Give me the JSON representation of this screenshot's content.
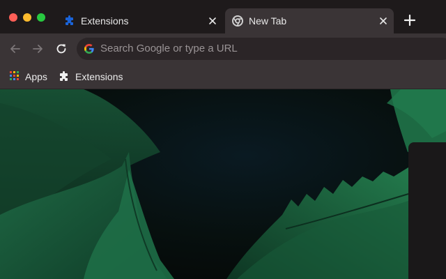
{
  "window": {
    "controls": [
      "close",
      "minimize",
      "maximize"
    ]
  },
  "tabs": [
    {
      "title": "Extensions",
      "favicon": "puzzle-icon",
      "active": false
    },
    {
      "title": "New Tab",
      "favicon": "chrome-icon",
      "active": true
    }
  ],
  "toolbar": {
    "omnibox_placeholder": "Search Google or type a URL",
    "icons": [
      "back-arrow-icon",
      "forward-arrow-icon",
      "reload-icon",
      "google-icon"
    ]
  },
  "bookmarks": [
    {
      "label": "Apps",
      "icon": "apps-grid-icon"
    },
    {
      "label": "Extensions",
      "icon": "puzzle-icon"
    }
  ],
  "theme": {
    "frame": "#1e1a1b",
    "toolbar": "#3a3436",
    "leaf_green": "#1d5a39",
    "extension_blue": "#1a63d8"
  }
}
